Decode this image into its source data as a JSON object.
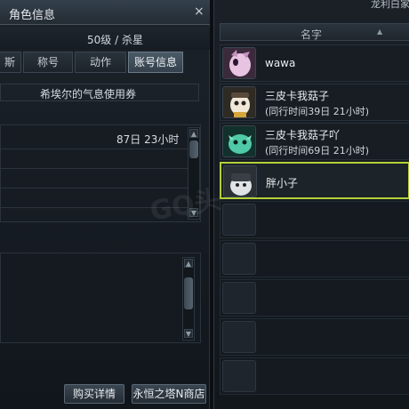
{
  "left_panel": {
    "title": "角色信息",
    "close_glyph": "×",
    "level": "50级 / 杀星",
    "tabs": [
      "斯",
      "称号",
      "动作",
      "账号信息"
    ],
    "active_tab": 3,
    "coupon_label": "希埃尔的气息使用券",
    "remaining_time": "87日 23小时",
    "buttons": {
      "buy_details": "购买详情",
      "shop": "永恒之塔N商店"
    }
  },
  "right_panel": {
    "title": "龙利白家",
    "column_header": "名字",
    "friends": [
      {
        "name": "wawa",
        "detail": ""
      },
      {
        "name": "三皮卡我菇子",
        "detail": "(同行时间39日 21小时)"
      },
      {
        "name": "三皮卡我菇子吖",
        "detail": "(同行时间69日 21小时)"
      },
      {
        "name": "胖小子",
        "detail": ""
      }
    ],
    "selected_index": 3
  },
  "watermark": "GQ头",
  "colors": {
    "accent_selected": "#b4cf3a",
    "active_tab": "#4b5a67",
    "panel_bg": "#1a2026"
  },
  "icons": {
    "close": "close-icon",
    "scroll_up": "scroll-up-arrow-icon",
    "scroll_down": "scroll-down-arrow-icon",
    "sort": "sort-arrow-icon"
  }
}
